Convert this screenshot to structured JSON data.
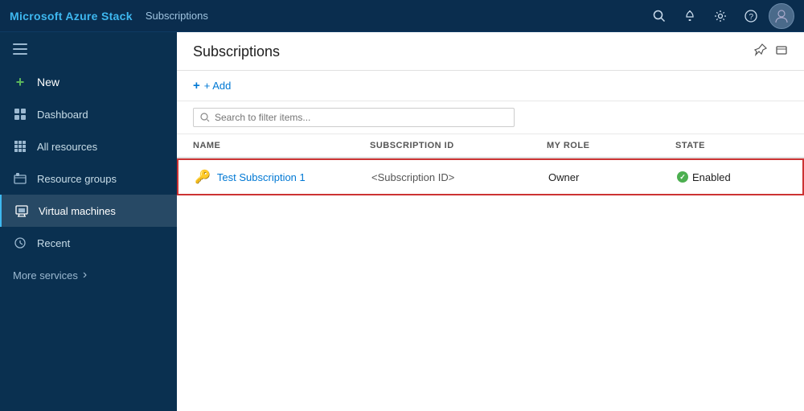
{
  "topbar": {
    "title": "Microsoft Azure Stack",
    "breadcrumb": "Subscriptions",
    "icons": {
      "search": "🔍",
      "bell": "🔔",
      "settings": "⚙",
      "help": "?"
    }
  },
  "sidebar": {
    "hamburger_icon": "☰",
    "items": [
      {
        "id": "new",
        "label": "New",
        "icon": "+",
        "active": false
      },
      {
        "id": "dashboard",
        "label": "Dashboard",
        "icon": "dashboard",
        "active": false
      },
      {
        "id": "all-resources",
        "label": "All resources",
        "icon": "grid",
        "active": false
      },
      {
        "id": "resource-groups",
        "label": "Resource groups",
        "icon": "rg",
        "active": false
      },
      {
        "id": "virtual-machines",
        "label": "Virtual machines",
        "icon": "vm",
        "active": true
      },
      {
        "id": "recent",
        "label": "Recent",
        "icon": "clock",
        "active": false
      }
    ],
    "more_services": "More services",
    "more_chevron": "›"
  },
  "content": {
    "title": "Subscriptions",
    "pin_icon": "📌",
    "maximize_icon": "⬜",
    "add_label": "+ Add",
    "search_placeholder": "Search to filter items...",
    "table": {
      "headers": [
        "NAME",
        "SUBSCRIPTION ID",
        "MY ROLE",
        "STATE",
        ""
      ],
      "rows": [
        {
          "name": "Test Subscription 1",
          "subscription_id": "<Subscription ID>",
          "role": "Owner",
          "state": "Enabled",
          "state_enabled": true,
          "more": "..."
        }
      ]
    }
  }
}
